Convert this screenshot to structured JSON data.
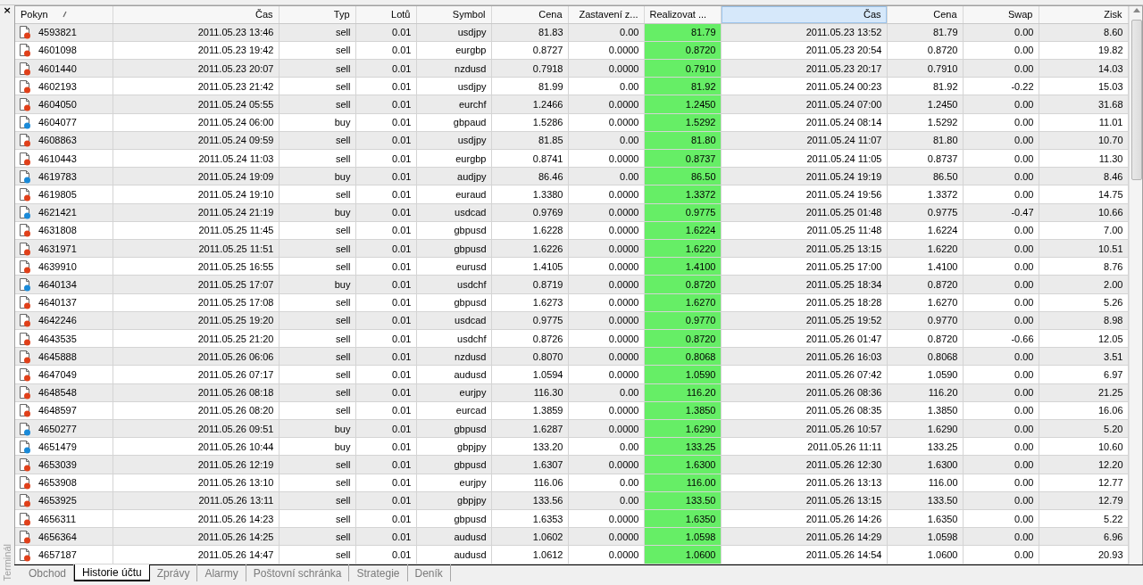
{
  "close_glyph": "×",
  "side_label": "Terminál",
  "table": {
    "columns": [
      {
        "label": "Pokyn",
        "selected": false,
        "highlight": false,
        "sorted": true
      },
      {
        "label": "Čas",
        "selected": false,
        "highlight": false,
        "sorted": false
      },
      {
        "label": "Typ",
        "selected": false,
        "highlight": false,
        "sorted": false
      },
      {
        "label": "Lotů",
        "selected": false,
        "highlight": false,
        "sorted": false
      },
      {
        "label": "Symbol",
        "selected": false,
        "highlight": false,
        "sorted": false
      },
      {
        "label": "Cena",
        "selected": false,
        "highlight": false,
        "sorted": false
      },
      {
        "label": "Zastavení z...",
        "selected": false,
        "highlight": false,
        "sorted": false
      },
      {
        "label": "Realizovat ...",
        "selected": false,
        "highlight": true,
        "sorted": false
      },
      {
        "label": "Čas",
        "selected": true,
        "highlight": false,
        "sorted": false
      },
      {
        "label": "Cena",
        "selected": false,
        "highlight": false,
        "sorted": false
      },
      {
        "label": "Swap",
        "selected": false,
        "highlight": false,
        "sorted": false
      },
      {
        "label": "Zisk",
        "selected": false,
        "highlight": false,
        "sorted": false
      }
    ],
    "rows": [
      {
        "color": "#e0401a",
        "cells": [
          "4593821",
          "2011.05.23 13:46",
          "sell",
          "0.01",
          "usdjpy",
          "81.83",
          "0.00",
          "81.79",
          "2011.05.23 13:52",
          "81.79",
          "0.00",
          "8.60"
        ]
      },
      {
        "color": "#e0401a",
        "cells": [
          "4601098",
          "2011.05.23 19:42",
          "sell",
          "0.01",
          "eurgbp",
          "0.8727",
          "0.0000",
          "0.8720",
          "2011.05.23 20:54",
          "0.8720",
          "0.00",
          "19.82"
        ]
      },
      {
        "color": "#e0401a",
        "cells": [
          "4601440",
          "2011.05.23 20:07",
          "sell",
          "0.01",
          "nzdusd",
          "0.7918",
          "0.0000",
          "0.7910",
          "2011.05.23 20:17",
          "0.7910",
          "0.00",
          "14.03"
        ]
      },
      {
        "color": "#e0401a",
        "cells": [
          "4602193",
          "2011.05.23 21:42",
          "sell",
          "0.01",
          "usdjpy",
          "81.99",
          "0.00",
          "81.92",
          "2011.05.24 00:23",
          "81.92",
          "-0.22",
          "15.03"
        ]
      },
      {
        "color": "#e0401a",
        "cells": [
          "4604050",
          "2011.05.24 05:55",
          "sell",
          "0.01",
          "eurchf",
          "1.2466",
          "0.0000",
          "1.2450",
          "2011.05.24 07:00",
          "1.2450",
          "0.00",
          "31.68"
        ]
      },
      {
        "color": "#1a8ad8",
        "cells": [
          "4604077",
          "2011.05.24 06:00",
          "buy",
          "0.01",
          "gbpaud",
          "1.5286",
          "0.0000",
          "1.5292",
          "2011.05.24 08:14",
          "1.5292",
          "0.00",
          "11.01"
        ]
      },
      {
        "color": "#e0401a",
        "cells": [
          "4608863",
          "2011.05.24 09:59",
          "sell",
          "0.01",
          "usdjpy",
          "81.85",
          "0.00",
          "81.80",
          "2011.05.24 11:07",
          "81.80",
          "0.00",
          "10.70"
        ]
      },
      {
        "color": "#e0401a",
        "cells": [
          "4610443",
          "2011.05.24 11:03",
          "sell",
          "0.01",
          "eurgbp",
          "0.8741",
          "0.0000",
          "0.8737",
          "2011.05.24 11:05",
          "0.8737",
          "0.00",
          "11.30"
        ]
      },
      {
        "color": "#1a8ad8",
        "cells": [
          "4619783",
          "2011.05.24 19:09",
          "buy",
          "0.01",
          "audjpy",
          "86.46",
          "0.00",
          "86.50",
          "2011.05.24 19:19",
          "86.50",
          "0.00",
          "8.46"
        ]
      },
      {
        "color": "#e0401a",
        "cells": [
          "4619805",
          "2011.05.24 19:10",
          "sell",
          "0.01",
          "euraud",
          "1.3380",
          "0.0000",
          "1.3372",
          "2011.05.24 19:56",
          "1.3372",
          "0.00",
          "14.75"
        ]
      },
      {
        "color": "#1a8ad8",
        "cells": [
          "4621421",
          "2011.05.24 21:19",
          "buy",
          "0.01",
          "usdcad",
          "0.9769",
          "0.0000",
          "0.9775",
          "2011.05.25 01:48",
          "0.9775",
          "-0.47",
          "10.66"
        ]
      },
      {
        "color": "#e0401a",
        "cells": [
          "4631808",
          "2011.05.25 11:45",
          "sell",
          "0.01",
          "gbpusd",
          "1.6228",
          "0.0000",
          "1.6224",
          "2011.05.25 11:48",
          "1.6224",
          "0.00",
          "7.00"
        ]
      },
      {
        "color": "#e0401a",
        "cells": [
          "4631971",
          "2011.05.25 11:51",
          "sell",
          "0.01",
          "gbpusd",
          "1.6226",
          "0.0000",
          "1.6220",
          "2011.05.25 13:15",
          "1.6220",
          "0.00",
          "10.51"
        ]
      },
      {
        "color": "#e0401a",
        "cells": [
          "4639910",
          "2011.05.25 16:55",
          "sell",
          "0.01",
          "eurusd",
          "1.4105",
          "0.0000",
          "1.4100",
          "2011.05.25 17:00",
          "1.4100",
          "0.00",
          "8.76"
        ]
      },
      {
        "color": "#1a8ad8",
        "cells": [
          "4640134",
          "2011.05.25 17:07",
          "buy",
          "0.01",
          "usdchf",
          "0.8719",
          "0.0000",
          "0.8720",
          "2011.05.25 18:34",
          "0.8720",
          "0.00",
          "2.00"
        ]
      },
      {
        "color": "#e0401a",
        "cells": [
          "4640137",
          "2011.05.25 17:08",
          "sell",
          "0.01",
          "gbpusd",
          "1.6273",
          "0.0000",
          "1.6270",
          "2011.05.25 18:28",
          "1.6270",
          "0.00",
          "5.26"
        ]
      },
      {
        "color": "#e0401a",
        "cells": [
          "4642246",
          "2011.05.25 19:20",
          "sell",
          "0.01",
          "usdcad",
          "0.9775",
          "0.0000",
          "0.9770",
          "2011.05.25 19:52",
          "0.9770",
          "0.00",
          "8.98"
        ]
      },
      {
        "color": "#e0401a",
        "cells": [
          "4643535",
          "2011.05.25 21:20",
          "sell",
          "0.01",
          "usdchf",
          "0.8726",
          "0.0000",
          "0.8720",
          "2011.05.26 01:47",
          "0.8720",
          "-0.66",
          "12.05"
        ]
      },
      {
        "color": "#e0401a",
        "cells": [
          "4645888",
          "2011.05.26 06:06",
          "sell",
          "0.01",
          "nzdusd",
          "0.8070",
          "0.0000",
          "0.8068",
          "2011.05.26 16:03",
          "0.8068",
          "0.00",
          "3.51"
        ]
      },
      {
        "color": "#e0401a",
        "cells": [
          "4647049",
          "2011.05.26 07:17",
          "sell",
          "0.01",
          "audusd",
          "1.0594",
          "0.0000",
          "1.0590",
          "2011.05.26 07:42",
          "1.0590",
          "0.00",
          "6.97"
        ]
      },
      {
        "color": "#e0401a",
        "cells": [
          "4648548",
          "2011.05.26 08:18",
          "sell",
          "0.01",
          "eurjpy",
          "116.30",
          "0.00",
          "116.20",
          "2011.05.26 08:36",
          "116.20",
          "0.00",
          "21.25"
        ]
      },
      {
        "color": "#e0401a",
        "cells": [
          "4648597",
          "2011.05.26 08:20",
          "sell",
          "0.01",
          "eurcad",
          "1.3859",
          "0.0000",
          "1.3850",
          "2011.05.26 08:35",
          "1.3850",
          "0.00",
          "16.06"
        ]
      },
      {
        "color": "#1a8ad8",
        "cells": [
          "4650277",
          "2011.05.26 09:51",
          "buy",
          "0.01",
          "gbpusd",
          "1.6287",
          "0.0000",
          "1.6290",
          "2011.05.26 10:57",
          "1.6290",
          "0.00",
          "5.20"
        ]
      },
      {
        "color": "#1a8ad8",
        "cells": [
          "4651479",
          "2011.05.26 10:44",
          "buy",
          "0.01",
          "gbpjpy",
          "133.20",
          "0.00",
          "133.25",
          "2011.05.26 11:11",
          "133.25",
          "0.00",
          "10.60"
        ]
      },
      {
        "color": "#e0401a",
        "cells": [
          "4653039",
          "2011.05.26 12:19",
          "sell",
          "0.01",
          "gbpusd",
          "1.6307",
          "0.0000",
          "1.6300",
          "2011.05.26 12:30",
          "1.6300",
          "0.00",
          "12.20"
        ]
      },
      {
        "color": "#e0401a",
        "cells": [
          "4653908",
          "2011.05.26 13:10",
          "sell",
          "0.01",
          "eurjpy",
          "116.06",
          "0.00",
          "116.00",
          "2011.05.26 13:13",
          "116.00",
          "0.00",
          "12.77"
        ]
      },
      {
        "color": "#e0401a",
        "cells": [
          "4653925",
          "2011.05.26 13:11",
          "sell",
          "0.01",
          "gbpjpy",
          "133.56",
          "0.00",
          "133.50",
          "2011.05.26 13:15",
          "133.50",
          "0.00",
          "12.79"
        ]
      },
      {
        "color": "#e0401a",
        "cells": [
          "4656311",
          "2011.05.26 14:23",
          "sell",
          "0.01",
          "gbpusd",
          "1.6353",
          "0.0000",
          "1.6350",
          "2011.05.26 14:26",
          "1.6350",
          "0.00",
          "5.22"
        ]
      },
      {
        "color": "#e0401a",
        "cells": [
          "4656364",
          "2011.05.26 14:25",
          "sell",
          "0.01",
          "audusd",
          "1.0602",
          "0.0000",
          "1.0598",
          "2011.05.26 14:29",
          "1.0598",
          "0.00",
          "6.96"
        ]
      },
      {
        "color": "#e0401a",
        "cells": [
          "4657187",
          "2011.05.26 14:47",
          "sell",
          "0.01",
          "audusd",
          "1.0612",
          "0.0000",
          "1.0600",
          "2011.05.26 14:54",
          "1.0600",
          "0.00",
          "20.93"
        ]
      }
    ]
  },
  "tabs": [
    {
      "label": "Obchod",
      "selected": false
    },
    {
      "label": "Historie účtu",
      "selected": true
    },
    {
      "label": "Zprávy",
      "selected": false
    },
    {
      "label": "Alarmy",
      "selected": false
    },
    {
      "label": "Poštovní schránka",
      "selected": false
    },
    {
      "label": "Strategie",
      "selected": false
    },
    {
      "label": "Deník",
      "selected": false
    }
  ]
}
